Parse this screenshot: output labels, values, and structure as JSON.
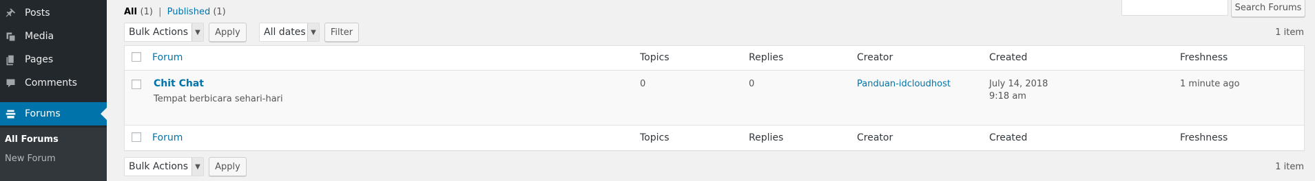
{
  "sidebar": {
    "items": [
      {
        "label": "Posts",
        "icon": "pushpin-icon"
      },
      {
        "label": "Media",
        "icon": "media-icon"
      },
      {
        "label": "Pages",
        "icon": "pages-icon"
      },
      {
        "label": "Comments",
        "icon": "comment-icon"
      },
      {
        "label": "Forums",
        "icon": "forums-icon"
      }
    ],
    "submenu": [
      "All Forums",
      "New Forum"
    ]
  },
  "filters": {
    "all_label": "All",
    "all_count": "(1)",
    "separator": "|",
    "published_label": "Published",
    "published_count": "(1)"
  },
  "search": {
    "value": "",
    "button_label": "Search Forums"
  },
  "top_nav": {
    "bulk_actions": "Bulk Actions",
    "apply_label": "Apply",
    "dates": "All dates",
    "filter_label": "Filter",
    "items_count": "1 item"
  },
  "bottom_nav": {
    "bulk_actions": "Bulk Actions",
    "apply_label": "Apply",
    "items_count": "1 item"
  },
  "table": {
    "columns": [
      "Forum",
      "Topics",
      "Replies",
      "Creator",
      "Created",
      "Freshness"
    ],
    "rows": [
      {
        "title": "Chit Chat",
        "description": "Tempat berbicara sehari-hari",
        "topics": "0",
        "replies": "0",
        "creator": "Panduan-idcloudhost",
        "created_date": "July 14, 2018",
        "created_time": "9:18 am",
        "freshness": "1 minute ago"
      }
    ]
  },
  "colors": {
    "accent": "#0073aa",
    "sidebar_bg": "#23282d",
    "submenu_bg": "#32373c"
  }
}
